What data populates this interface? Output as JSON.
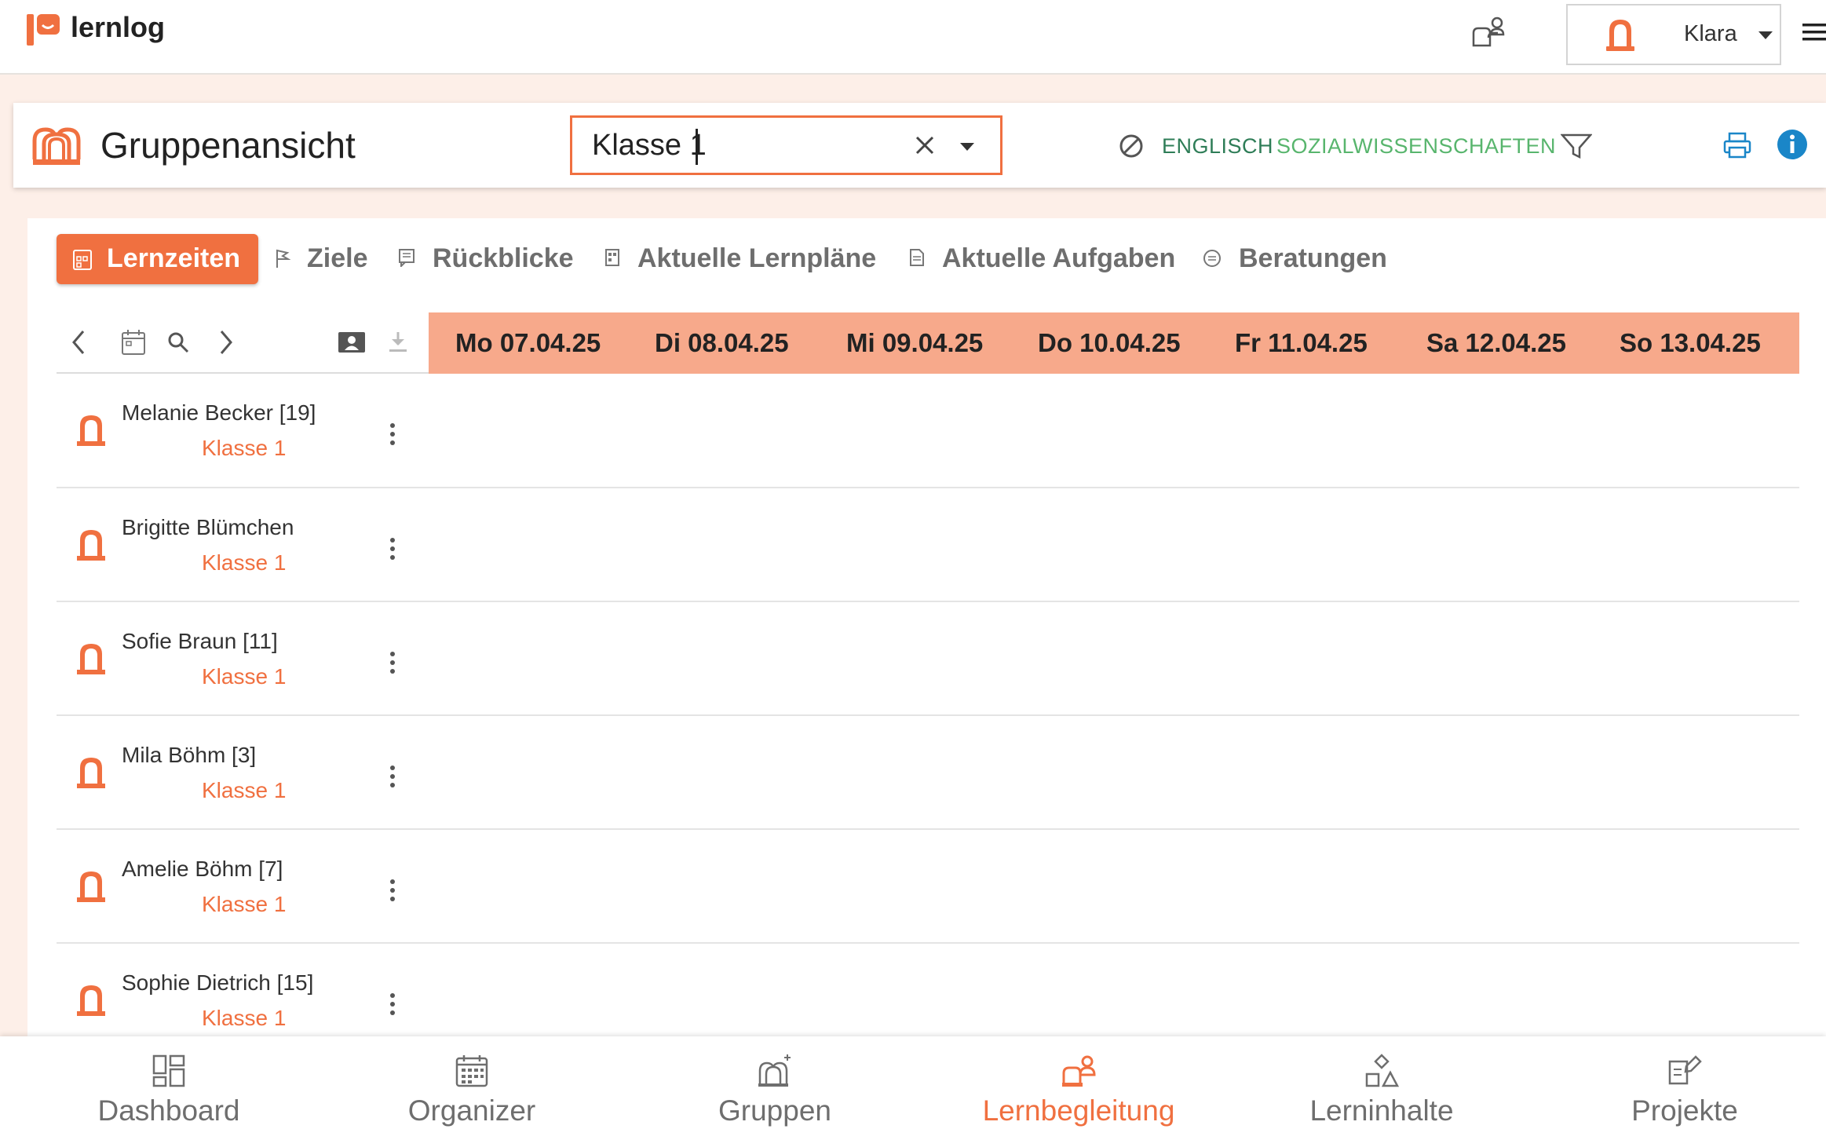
{
  "app": {
    "logo_text": "lernlog"
  },
  "topbar": {
    "user_name": "Klara"
  },
  "header": {
    "title": "Gruppenansicht",
    "group_select_value": "Klasse 1",
    "subjects": [
      "ENGLISCH",
      "SOZIALWISSENSCHAFTEN"
    ]
  },
  "tabs": [
    {
      "label": "Lernzeiten",
      "active": true
    },
    {
      "label": "Ziele"
    },
    {
      "label": "Rückblicke"
    },
    {
      "label": "Aktuelle Lernpläne"
    },
    {
      "label": "Aktuelle Aufgaben"
    },
    {
      "label": "Beratungen"
    }
  ],
  "days": [
    "Mo 07.04.25",
    "Di 08.04.25",
    "Mi 09.04.25",
    "Do 10.04.25",
    "Fr 11.04.25",
    "Sa 12.04.25",
    "So 13.04.25"
  ],
  "students": [
    {
      "name": "Melanie Becker [19]",
      "group": "Klasse 1"
    },
    {
      "name": "Brigitte Blümchen",
      "group": "Klasse 1"
    },
    {
      "name": "Sofie Braun [11]",
      "group": "Klasse 1"
    },
    {
      "name": "Mila Böhm [3]",
      "group": "Klasse 1"
    },
    {
      "name": "Amelie Böhm [7]",
      "group": "Klasse 1"
    },
    {
      "name": "Sophie Dietrich [15]",
      "group": "Klasse 1"
    }
  ],
  "bottom_nav": [
    {
      "label": "Dashboard",
      "active": false
    },
    {
      "label": "Organizer",
      "active": false
    },
    {
      "label": "Gruppen",
      "active": false
    },
    {
      "label": "Lernbegleitung",
      "active": true
    },
    {
      "label": "Lerninhalte",
      "active": false
    },
    {
      "label": "Projekte",
      "active": false
    }
  ],
  "colors": {
    "accent": "#f07040",
    "day_header": "#f7a98b",
    "subject_dark": "#2e7d57",
    "subject_light": "#58b56d",
    "info": "#1a86c8"
  }
}
